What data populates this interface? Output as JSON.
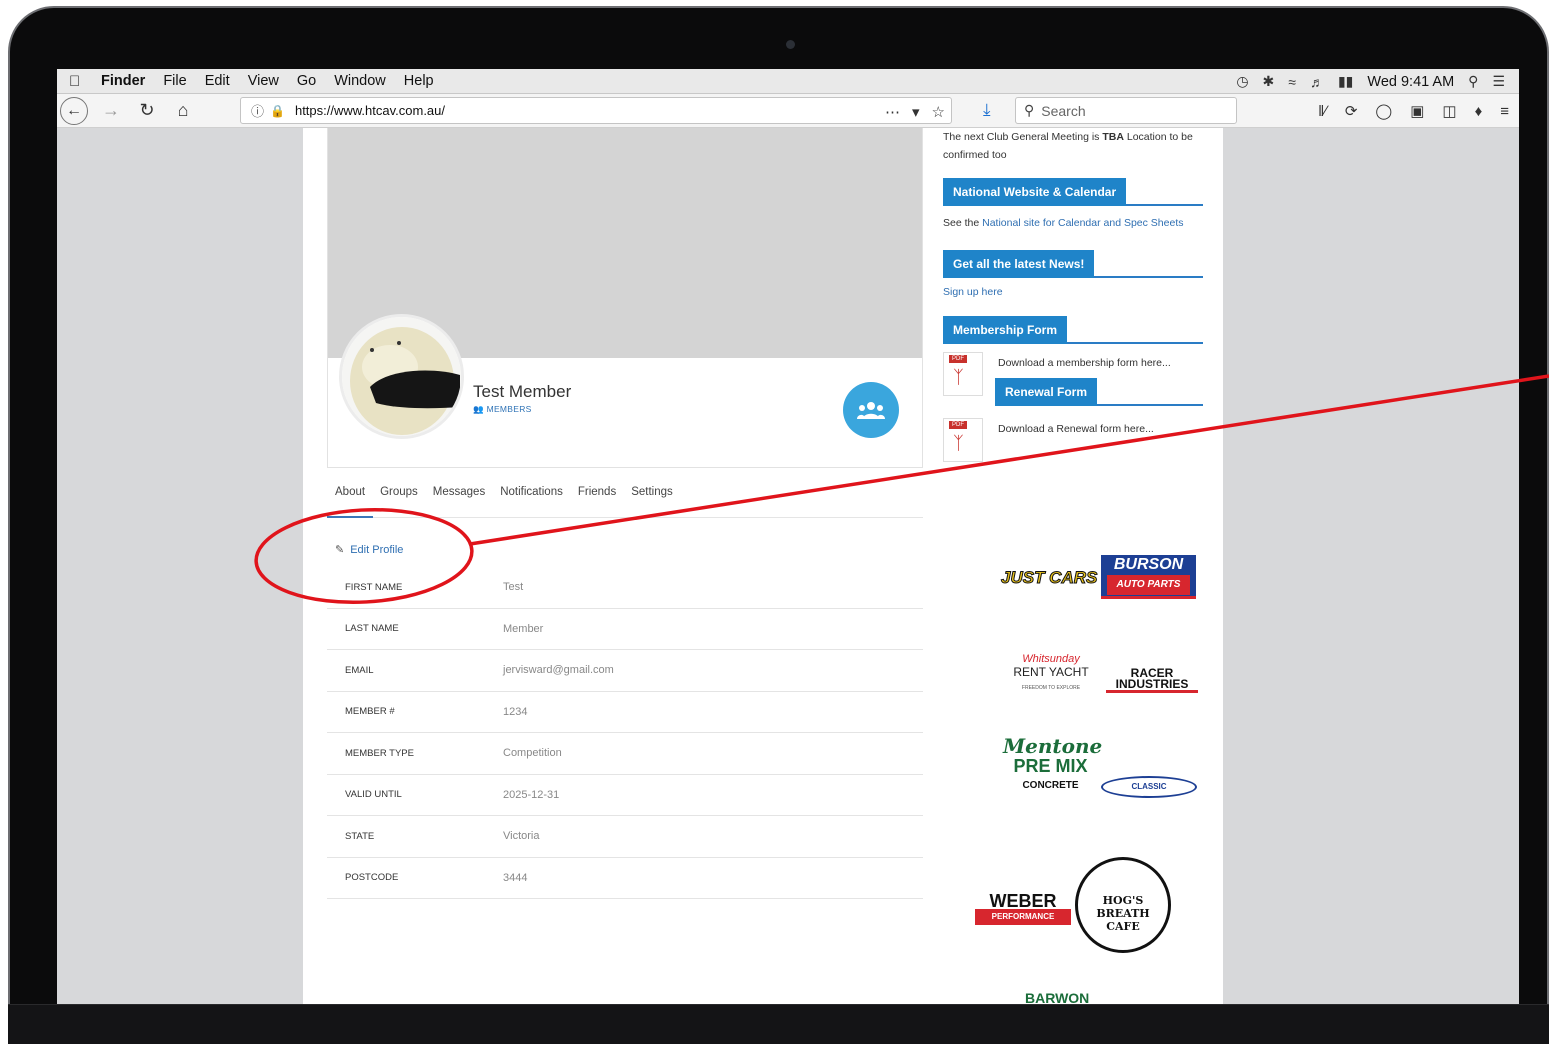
{
  "menubar": {
    "app": "Finder",
    "items": [
      "File",
      "Edit",
      "View",
      "Go",
      "Window",
      "Help"
    ],
    "clock": "Wed 9:41 AM"
  },
  "browser": {
    "url": "https://www.htcav.com.au/",
    "search_placeholder": "Search"
  },
  "profile": {
    "name": "Test Member",
    "group": "MEMBERS",
    "tabs": [
      "About",
      "Groups",
      "Messages",
      "Notifications",
      "Friends",
      "Settings"
    ],
    "edit_label": "Edit Profile",
    "fields": [
      {
        "label": "FIRST NAME",
        "value": "Test"
      },
      {
        "label": "LAST NAME",
        "value": "Member"
      },
      {
        "label": "EMAIL",
        "value": "jervisward@gmail.com"
      },
      {
        "label": "MEMBER #",
        "value": "1234"
      },
      {
        "label": "MEMBER TYPE",
        "value": "Competition"
      },
      {
        "label": "VALID UNTIL",
        "value": "2025-12-31"
      },
      {
        "label": "STATE",
        "value": "Victoria"
      },
      {
        "label": "POSTCODE",
        "value": "3444"
      }
    ]
  },
  "sidebar": {
    "meeting_prefix": "The next Club General Meeting is",
    "meeting_bold": "TBA",
    "meeting_suffix": "Location to be confirmed too",
    "national_head": "National Website & Calendar",
    "national_prefix": "See the",
    "national_link": "National site for Calendar and Spec Sheets",
    "news_head": "Get all the latest News!",
    "news_link": "Sign up here",
    "membership_head": "Membership Form",
    "membership_text": "Download a membership form here...",
    "renewal_head": "Renewal Form",
    "renewal_text": "Download a Renewal form here...",
    "pdf_tag": "PDF"
  },
  "sponsors": {
    "justcars": "JUST CARS",
    "burson": "BURSON",
    "burson_sub": "AUTO PARTS",
    "rentyacht": "RENT YACHT",
    "rentyacht_script": "Whitsunday",
    "rentyacht_sub": "FREEDOM TO EXPLORE",
    "racer": "RACER INDUSTRIES",
    "mentone": "Mentone",
    "premix": "PRE MIX",
    "concrete": "CONCRETE",
    "classic": "CLASSIC",
    "weber": "WEBER",
    "weber_sub": "PERFORMANCE",
    "hogs": "HOG'S BREATH CAFE",
    "barwon": "BARWON"
  },
  "colors": {
    "accent": "#1f84c9",
    "annotation": "#e0141b"
  }
}
